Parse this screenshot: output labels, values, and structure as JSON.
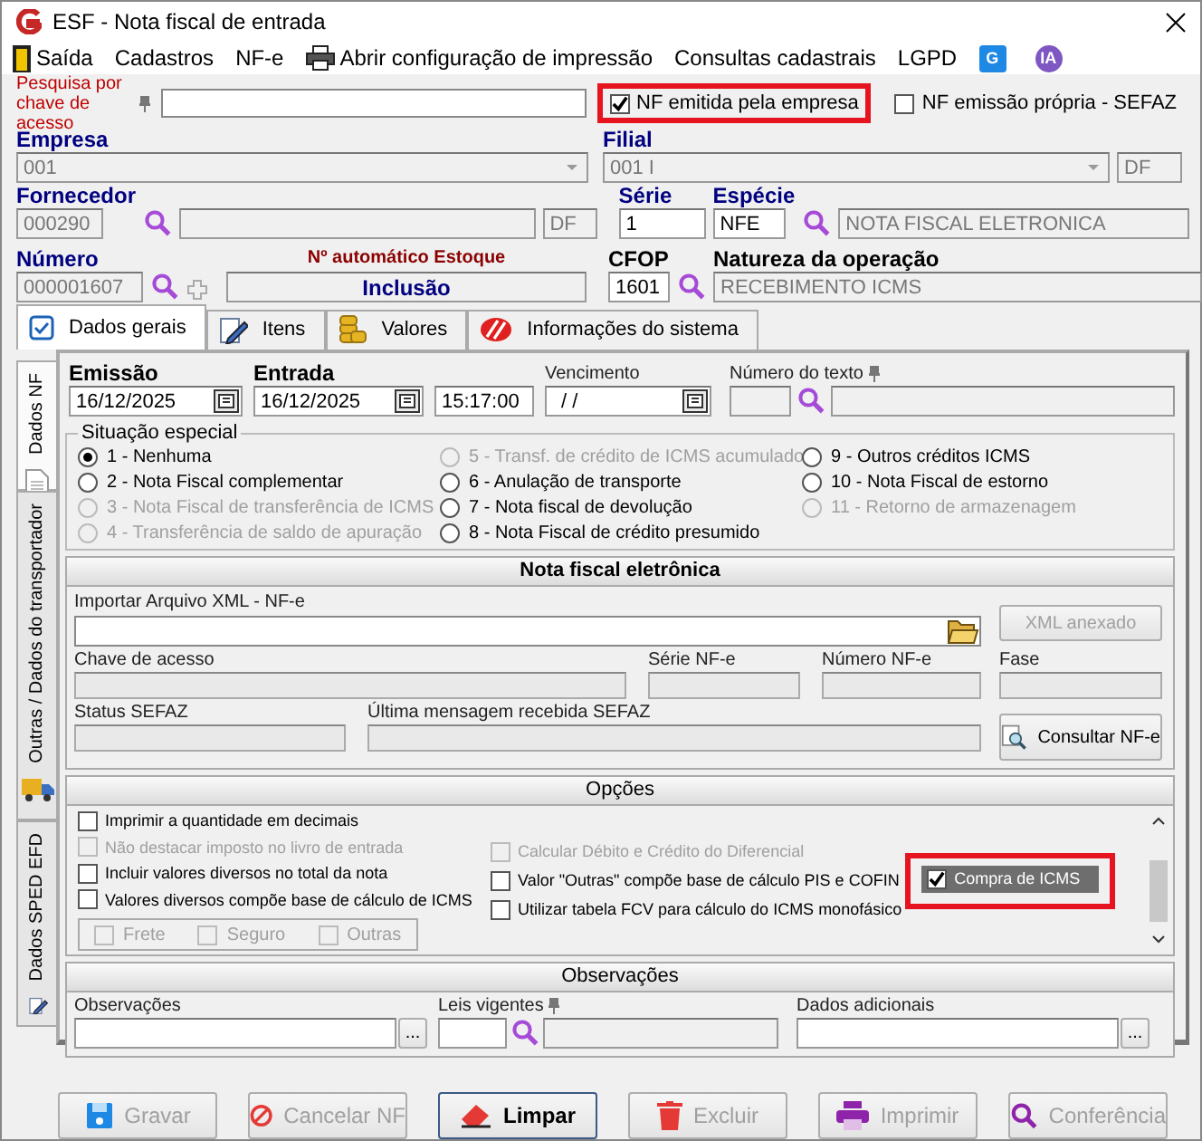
{
  "window": {
    "title": "ESF - Nota fiscal de entrada"
  },
  "menu": [
    {
      "label": "Saída",
      "kind": "exit"
    },
    {
      "label": "Cadastros",
      "kind": "plain"
    },
    {
      "label": "NF-e",
      "kind": "plain"
    },
    {
      "label": "Abrir configuração de impressão",
      "kind": "printer"
    },
    {
      "label": "Consultas cadastrais",
      "kind": "plain"
    },
    {
      "label": "LGPD",
      "kind": "plain"
    }
  ],
  "menu_badges": [
    {
      "text": "G",
      "kind": "square"
    },
    {
      "text": "IA",
      "kind": "circle"
    }
  ],
  "search": {
    "label": "Pesquisa por chave de acesso"
  },
  "flags": [
    {
      "label": "NF emitida pela empresa",
      "checked": true,
      "highlighted": true
    },
    {
      "label": "NF emissão própria - SEFAZ",
      "checked": false,
      "highlighted": false
    }
  ],
  "empresa": {
    "label": "Empresa",
    "value": "001"
  },
  "filial": {
    "label": "Filial",
    "value": "001 I",
    "uf": "DF"
  },
  "fornecedor": {
    "label": "Fornecedor",
    "code": "000290",
    "uf": "DF"
  },
  "serie": {
    "label": "Série",
    "value": "1"
  },
  "especie": {
    "label": "Espécie",
    "code": "NFE",
    "description": "NOTA FISCAL ELETRONICA"
  },
  "numero": {
    "label": "Número",
    "value": "000001607"
  },
  "automatico": {
    "label": "Nº automático Estoque",
    "value": "Inclusão"
  },
  "cfop": {
    "label": "CFOP",
    "value": "1601"
  },
  "natureza": {
    "label": "Natureza da operação",
    "value": "RECEBIMENTO ICMS"
  },
  "tabs": [
    {
      "label": "Dados gerais",
      "kind": "check",
      "selected": true
    },
    {
      "label": "Itens",
      "kind": "pencil",
      "selected": false
    },
    {
      "label": "Valores",
      "kind": "coins",
      "selected": false
    },
    {
      "label": "Informações do sistema",
      "kind": "stripes",
      "selected": false
    }
  ],
  "side_tabs": [
    {
      "label": "Dados NF",
      "kind": "page",
      "selected": true
    },
    {
      "label": "Outras / Dados do transportador",
      "kind": "truck",
      "selected": false
    },
    {
      "label": "Dados SPED EFD",
      "kind": "pencil",
      "selected": false
    }
  ],
  "emissao": {
    "label": "Emissão",
    "value": "16/12/2025"
  },
  "entrada": {
    "label": "Entrada",
    "value": "16/12/2025",
    "time": "15:17:00"
  },
  "vencimento": {
    "label": "Vencimento",
    "value": "/  /"
  },
  "numero_texto": {
    "label": "Número do texto"
  },
  "situacao": {
    "title": "Situação especial",
    "options": [
      {
        "label": "1 - Nenhuma",
        "selected": true,
        "disabled": false
      },
      {
        "label": "2 - Nota Fiscal complementar",
        "selected": false,
        "disabled": false
      },
      {
        "label": "3 - Nota Fiscal de transferência de ICMS",
        "selected": false,
        "disabled": true
      },
      {
        "label": "4 - Transferência de saldo de apuração",
        "selected": false,
        "disabled": true
      },
      {
        "label": "5 - Transf. de crédito de ICMS acumulado",
        "selected": false,
        "disabled": true
      },
      {
        "label": "6 - Anulação de transporte",
        "selected": false,
        "disabled": false
      },
      {
        "label": "7 - Nota fiscal de devolução",
        "selected": false,
        "disabled": false
      },
      {
        "label": "8 - Nota Fiscal de crédito presumido",
        "selected": false,
        "disabled": false
      },
      {
        "label": "9 - Outros créditos ICMS",
        "selected": false,
        "disabled": false
      },
      {
        "label": "10 - Nota Fiscal de estorno",
        "selected": false,
        "disabled": false
      },
      {
        "label": "11 - Retorno de armazenagem",
        "selected": false,
        "disabled": true
      }
    ]
  },
  "nfe": {
    "title": "Nota fiscal eletrônica",
    "import_label": "Importar Arquivo XML - NF-e",
    "xml_button": {
      "label": "XML anexado",
      "disabled": true
    },
    "chave_label": "Chave de acesso",
    "serie_label": "Série NF-e",
    "numero_label": "Número NF-e",
    "fase_label": "Fase",
    "status_label": "Status SEFAZ",
    "mensagem_label": "Última mensagem recebida SEFAZ",
    "consultar_button": "Consultar NF-e"
  },
  "opcoes": {
    "title": "Opções",
    "left": [
      {
        "label": "Imprimir a quantidade em decimais",
        "checked": false,
        "disabled": false
      },
      {
        "label": "Não destacar imposto no livro de entrada",
        "checked": false,
        "disabled": true
      },
      {
        "label": "Incluir valores diversos no total da nota",
        "checked": false,
        "disabled": false
      },
      {
        "label": "Valores diversos compõe base de cálculo de ICMS",
        "checked": false,
        "disabled": false
      }
    ],
    "right": [
      {
        "label": "Calcular Débito e Crédito do Diferencial",
        "checked": false,
        "disabled": true
      },
      {
        "label": "Valor \"Outras\" compõe base de cálculo PIS e COFIN",
        "checked": false,
        "disabled": false
      },
      {
        "label": "Utilizar tabela FCV para cálculo do ICMS monofásico",
        "checked": false,
        "disabled": false
      }
    ],
    "sub": [
      {
        "label": "Frete",
        "checked": false,
        "disabled": true
      },
      {
        "label": "Seguro",
        "checked": false,
        "disabled": true
      },
      {
        "label": "Outras",
        "checked": false,
        "disabled": true
      }
    ],
    "compra": {
      "label": "Compra de ICMS",
      "checked": true,
      "focused": true,
      "highlighted": true
    }
  },
  "observacoes": {
    "title": "Observações",
    "observacoes_label": "Observações",
    "leis_label": "Leis vigentes",
    "adicionais_label": "Dados adicionais",
    "more_button": "..."
  },
  "buttons": [
    {
      "label": "Gravar",
      "kind": "disk",
      "disabled": true,
      "focused": false
    },
    {
      "label": "Cancelar NF",
      "kind": "stop",
      "disabled": true,
      "focused": false
    },
    {
      "label": "Limpar",
      "kind": "eraser",
      "disabled": false,
      "focused": true
    },
    {
      "label": "Excluir",
      "kind": "trash",
      "disabled": true,
      "focused": false
    },
    {
      "label": "Imprimir",
      "kind": "printer",
      "disabled": true,
      "focused": false
    },
    {
      "label": "Conferência",
      "kind": "search",
      "disabled": true,
      "focused": false
    }
  ]
}
